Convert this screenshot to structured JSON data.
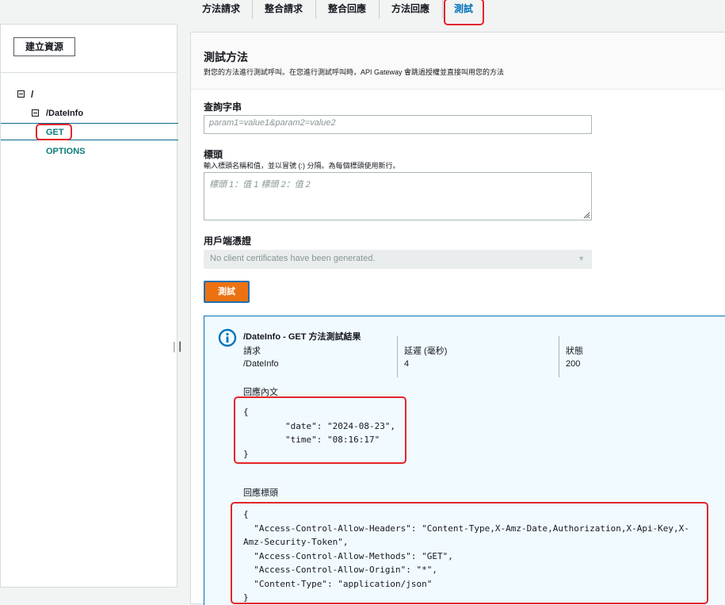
{
  "tabs": [
    "方法請求",
    "整合請求",
    "整合回應",
    "方法回應",
    "測試"
  ],
  "sidebar": {
    "create_button": "建立資源",
    "tree": {
      "root": "/",
      "resource": "/DateInfo",
      "methods": [
        "GET",
        "OPTIONS"
      ]
    }
  },
  "main": {
    "title": "測試方法",
    "description": "對您的方法進行測試呼叫。在您進行測試呼叫時，API Gateway 會跳過授權並直接叫用您的方法",
    "query": {
      "label": "查詢字串",
      "placeholder": "param1=value1&param2=value2"
    },
    "headers": {
      "label": "標頭",
      "hint": "輸入標頭名稱和值，並以冒號 (:) 分隔。為每個標頭使用新行。",
      "placeholder": "標頭 1：值 1 標頭 2：值 2"
    },
    "client_cert": {
      "label": "用戶端憑證",
      "value": "No client certificates have been generated."
    },
    "test_button": "測試",
    "result": {
      "title": "/DateInfo - GET 方法測試結果",
      "columns": {
        "request": "請求",
        "latency": "延遲 (毫秒)",
        "status": "狀態"
      },
      "values": {
        "request": "/DateInfo",
        "latency": "4",
        "status": "200"
      },
      "body_label": "回應內文",
      "body": "{\n        \"date\": \"2024-08-23\",\n        \"time\": \"08:16:17\"\n}",
      "headers_label": "回應標頭",
      "headers": "{\n  \"Access-Control-Allow-Headers\": \"Content-Type,X-Amz-Date,Authorization,X-Api-Key,X-Amz-Security-Token\",\n  \"Access-Control-Allow-Methods\": \"GET\",\n  \"Access-Control-Allow-Origin\": \"*\",\n  \"Content-Type\": \"application/json\"\n}"
    }
  },
  "colors": {
    "accent": "#0073bb",
    "highlight": "#e3262a",
    "button": "#ec7211",
    "method": "#0a7b7b"
  }
}
